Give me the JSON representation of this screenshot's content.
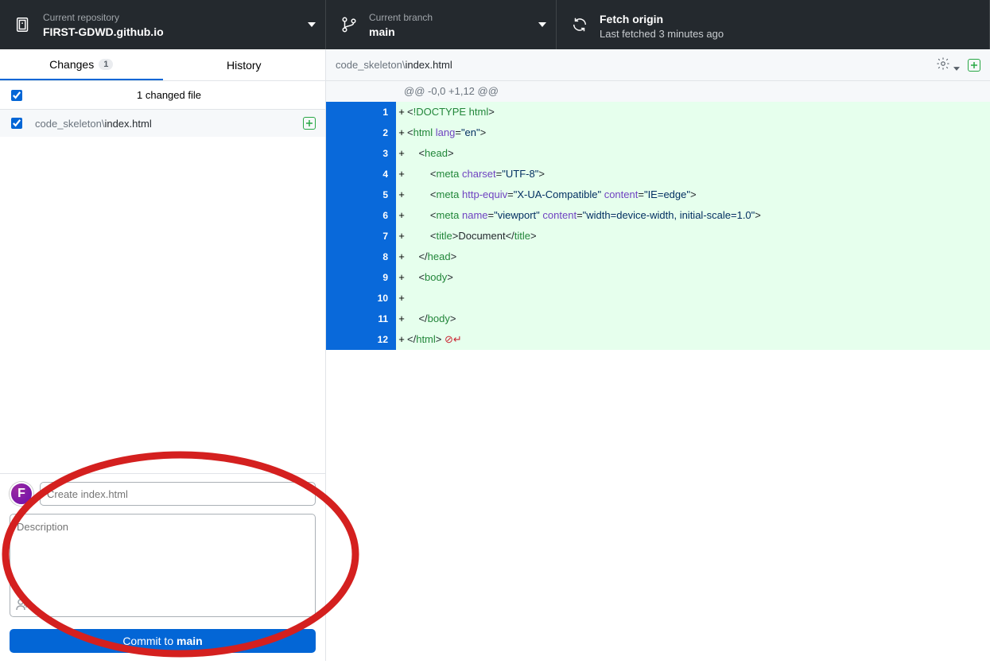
{
  "topbar": {
    "repo_label": "Current repository",
    "repo_name": "FIRST-GDWD.github.io",
    "branch_label": "Current branch",
    "branch_name": "main",
    "fetch_label": "Fetch origin",
    "fetch_sub": "Last fetched 3 minutes ago"
  },
  "tabs": {
    "changes": "Changes",
    "changes_count": "1",
    "history": "History"
  },
  "changes": {
    "header": "1 changed file",
    "file_dir": "code_skeleton\\",
    "file_name": "index.html"
  },
  "commit": {
    "avatar_letter": "F",
    "summary_placeholder": "Create index.html",
    "desc_placeholder": "Description",
    "button_prefix": "Commit to ",
    "button_branch": "main"
  },
  "diff": {
    "path_dir": "code_skeleton\\",
    "path_file": "index.html",
    "hunk": "@@ -0,0 +1,12 @@",
    "lines": [
      {
        "n": 1,
        "tokens": [
          [
            "punct",
            "<"
          ],
          [
            "doctype",
            "!DOCTYPE html"
          ],
          [
            "punct",
            ">"
          ]
        ]
      },
      {
        "n": 2,
        "tokens": [
          [
            "punct",
            "<"
          ],
          [
            "tag",
            "html "
          ],
          [
            "attr",
            "lang"
          ],
          [
            "punct",
            "="
          ],
          [
            "str",
            "\"en\""
          ],
          [
            "punct",
            ">"
          ]
        ]
      },
      {
        "n": 3,
        "tokens": [
          [
            "txt",
            "    "
          ],
          [
            "punct",
            "<"
          ],
          [
            "tag",
            "head"
          ],
          [
            "punct",
            ">"
          ]
        ]
      },
      {
        "n": 4,
        "tokens": [
          [
            "txt",
            "        "
          ],
          [
            "punct",
            "<"
          ],
          [
            "tag",
            "meta "
          ],
          [
            "attr",
            "charset"
          ],
          [
            "punct",
            "="
          ],
          [
            "str",
            "\"UTF-8\""
          ],
          [
            "punct",
            ">"
          ]
        ]
      },
      {
        "n": 5,
        "tokens": [
          [
            "txt",
            "        "
          ],
          [
            "punct",
            "<"
          ],
          [
            "tag",
            "meta "
          ],
          [
            "attr",
            "http-equiv"
          ],
          [
            "punct",
            "="
          ],
          [
            "str",
            "\"X-UA-Compatible\""
          ],
          [
            "txt",
            " "
          ],
          [
            "attr",
            "content"
          ],
          [
            "punct",
            "="
          ],
          [
            "str",
            "\"IE=edge\""
          ],
          [
            "punct",
            ">"
          ]
        ]
      },
      {
        "n": 6,
        "tokens": [
          [
            "txt",
            "        "
          ],
          [
            "punct",
            "<"
          ],
          [
            "tag",
            "meta "
          ],
          [
            "attr",
            "name"
          ],
          [
            "punct",
            "="
          ],
          [
            "str",
            "\"viewport\""
          ],
          [
            "txt",
            " "
          ],
          [
            "attr",
            "content"
          ],
          [
            "punct",
            "="
          ],
          [
            "str",
            "\"width=device-width, initial-scale=1.0\""
          ],
          [
            "punct",
            ">"
          ]
        ]
      },
      {
        "n": 7,
        "tokens": [
          [
            "txt",
            "        "
          ],
          [
            "punct",
            "<"
          ],
          [
            "tag",
            "title"
          ],
          [
            "punct",
            ">"
          ],
          [
            "txt",
            "Document"
          ],
          [
            "punct",
            "</"
          ],
          [
            "tag",
            "title"
          ],
          [
            "punct",
            ">"
          ]
        ]
      },
      {
        "n": 8,
        "tokens": [
          [
            "txt",
            "    "
          ],
          [
            "punct",
            "</"
          ],
          [
            "tag",
            "head"
          ],
          [
            "punct",
            ">"
          ]
        ]
      },
      {
        "n": 9,
        "tokens": [
          [
            "txt",
            "    "
          ],
          [
            "punct",
            "<"
          ],
          [
            "tag",
            "body"
          ],
          [
            "punct",
            ">"
          ]
        ]
      },
      {
        "n": 10,
        "tokens": []
      },
      {
        "n": 11,
        "tokens": [
          [
            "txt",
            "    "
          ],
          [
            "punct",
            "</"
          ],
          [
            "tag",
            "body"
          ],
          [
            "punct",
            ">"
          ]
        ]
      },
      {
        "n": 12,
        "tokens": [
          [
            "punct",
            "</"
          ],
          [
            "tag",
            "html"
          ],
          [
            "punct",
            ">"
          ],
          [
            "txt",
            " "
          ],
          [
            "eof",
            "⊘↵"
          ]
        ]
      }
    ]
  }
}
